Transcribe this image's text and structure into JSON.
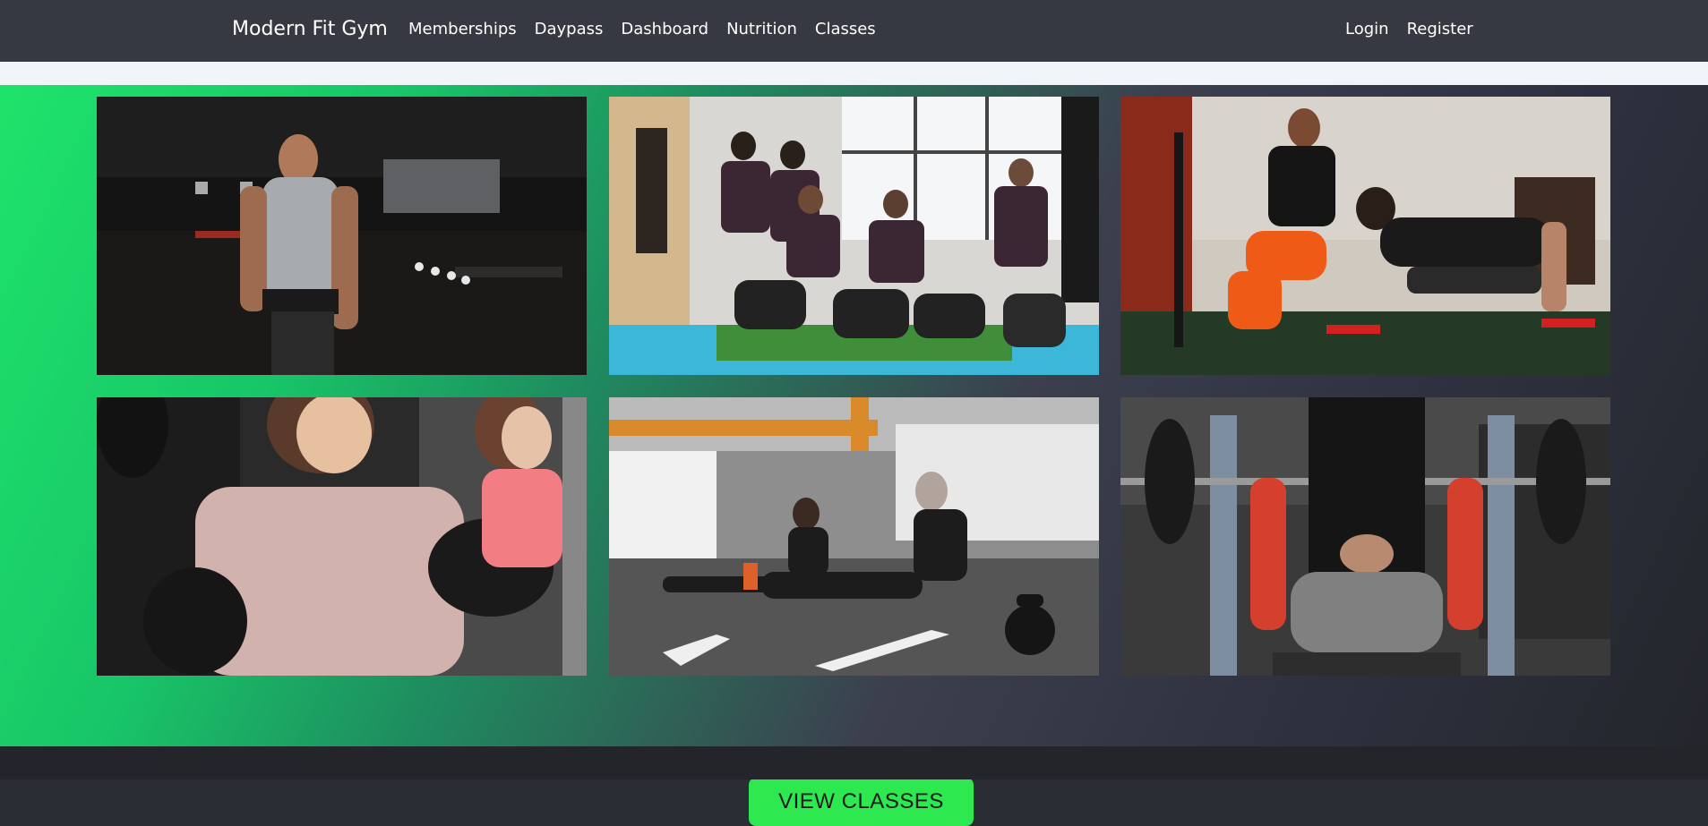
{
  "navbar": {
    "brand": "Modern Fit Gym",
    "links": [
      "Memberships",
      "Daypass",
      "Dashboard",
      "Nutrition",
      "Classes"
    ],
    "auth": [
      "Login",
      "Register"
    ]
  },
  "gallery": {
    "photos": [
      {
        "subject": "man in tank top with lifting belt in dark gym"
      },
      {
        "subject": "group indoor cycling class with coach"
      },
      {
        "subject": "trainer assisting man doing push-ups"
      },
      {
        "subject": "women boxing with gloves"
      },
      {
        "subject": "people stretching on gym floor"
      },
      {
        "subject": "spotter assisting man on bench press"
      }
    ]
  },
  "cta": {
    "label": "VIEW CLASSES"
  },
  "colors": {
    "navbar_bg": "#363941",
    "cta_bg": "#2ee850",
    "gradient_green": "#1ee36a",
    "gradient_dark": "#2f3140"
  }
}
